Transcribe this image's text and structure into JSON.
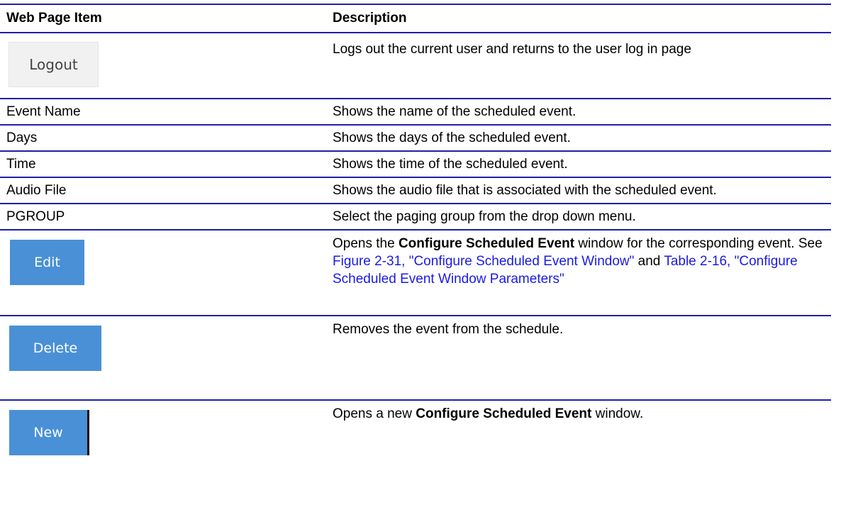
{
  "table": {
    "header": {
      "item": "Web Page Item",
      "description": "Description"
    },
    "rows": {
      "logout": {
        "button_label": "Logout",
        "description": "Logs out the current user and returns to the user log in page"
      },
      "event_name": {
        "item": "Event Name",
        "description": "Shows the name of the scheduled event."
      },
      "days": {
        "item": "Days",
        "description": "Shows the days of the scheduled event."
      },
      "time": {
        "item": "Time",
        "description": "Shows the time of the scheduled event."
      },
      "audio_file": {
        "item": "Audio File",
        "description": "Shows the audio file that is associated with the scheduled event."
      },
      "pgroup": {
        "item": "PGROUP",
        "description": "Select the paging group from the drop down menu."
      },
      "edit": {
        "button_label": "Edit",
        "desc_part1": "Opens the ",
        "desc_bold": "Configure Scheduled Event",
        "desc_part2": " window for the corresponding event. See ",
        "link1": "Figure 2-31, \"Configure Scheduled Event Window\"",
        "desc_and": " and ",
        "link2": "Table 2-16, \"Configure Scheduled Event Window Parameters\""
      },
      "delete": {
        "button_label": "Delete",
        "description": "Removes the event from the schedule."
      },
      "new": {
        "button_label": "New",
        "desc_part1": "Opens a new ",
        "desc_bold": "Configure Scheduled Event",
        "desc_part2": " window."
      }
    }
  },
  "colors": {
    "rule": "#1f1fa6",
    "link": "#1a1ae6",
    "button_blue": "#4a90d6",
    "button_grey": "#f1f1f1"
  }
}
